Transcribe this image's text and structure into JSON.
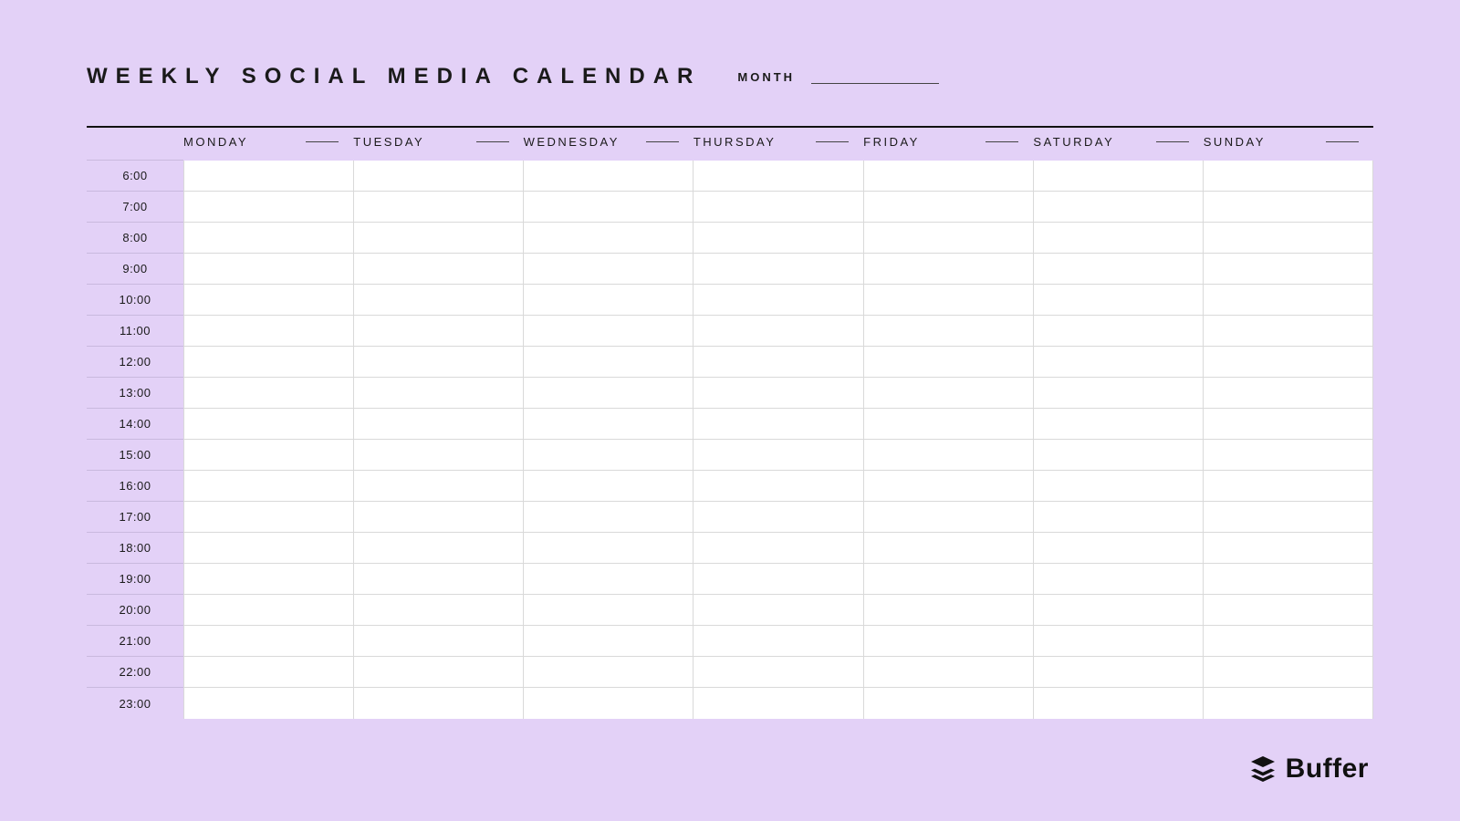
{
  "header": {
    "title": "WEEKLY SOCIAL MEDIA CALENDAR",
    "month_label": "MONTH",
    "month_value": ""
  },
  "days": [
    "MONDAY",
    "TUESDAY",
    "WEDNESDAY",
    "THURSDAY",
    "FRIDAY",
    "SATURDAY",
    "SUNDAY"
  ],
  "hours": [
    "6:00",
    "7:00",
    "8:00",
    "9:00",
    "10:00",
    "11:00",
    "12:00",
    "13:00",
    "14:00",
    "15:00",
    "16:00",
    "17:00",
    "18:00",
    "19:00",
    "20:00",
    "21:00",
    "22:00",
    "23:00"
  ],
  "footer": {
    "brand": "Buffer"
  }
}
